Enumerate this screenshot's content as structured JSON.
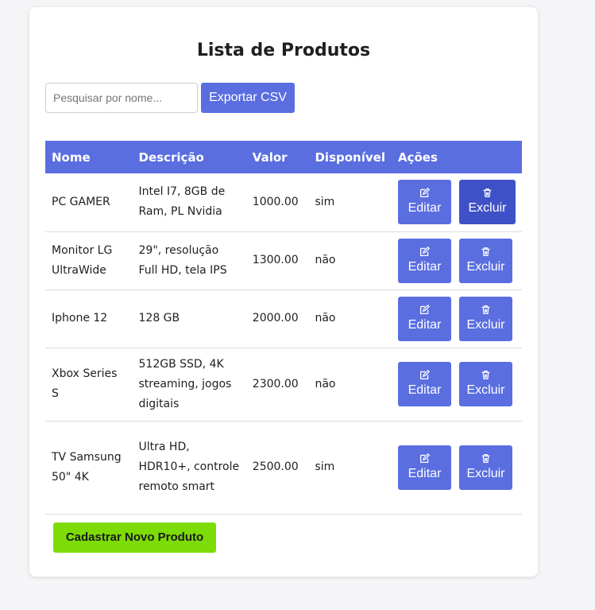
{
  "page": {
    "title": "Lista de Produtos",
    "search_placeholder": "Pesquisar por nome...",
    "search_value": "",
    "export_label": "Exportar CSV",
    "new_product_label": "Cadastrar Novo Produto"
  },
  "table": {
    "headers": [
      "Nome",
      "Descrição",
      "Valor",
      "Disponível",
      "Ações"
    ],
    "rows": [
      {
        "nome": "PC GAMER",
        "descricao": "Intel I7, 8GB de Ram, PL Nvidia",
        "valor": "1000.00",
        "disponivel": "sim",
        "edit": "Editar",
        "delete": "Excluir"
      },
      {
        "nome": "Monitor LG UltraWide",
        "descricao": "29\", resolução Full HD, tela IPS",
        "valor": "1300.00",
        "disponivel": "não",
        "edit": "Editar",
        "delete": "Excluir"
      },
      {
        "nome": "Iphone 12",
        "descricao": "128 GB",
        "valor": "2000.00",
        "disponivel": "não",
        "edit": "Editar",
        "delete": "Excluir"
      },
      {
        "nome": "Xbox Series S",
        "descricao": "512GB SSD, 4K streaming, jogos digitais",
        "valor": "2300.00",
        "disponivel": "não",
        "edit": "Editar",
        "delete": "Excluir"
      },
      {
        "nome": "TV Samsung 50\" 4K",
        "descricao": "Ultra HD, HDR10+, controle remoto smart",
        "valor": "2500.00",
        "disponivel": "sim",
        "edit": "Editar",
        "delete": "Excluir"
      }
    ]
  },
  "icons": {
    "edit": "edit-icon",
    "delete": "trash-icon"
  },
  "colors": {
    "accent": "#5a6ee0",
    "accent_hover": "#3f51c6",
    "primary_action": "#7ddc07"
  }
}
